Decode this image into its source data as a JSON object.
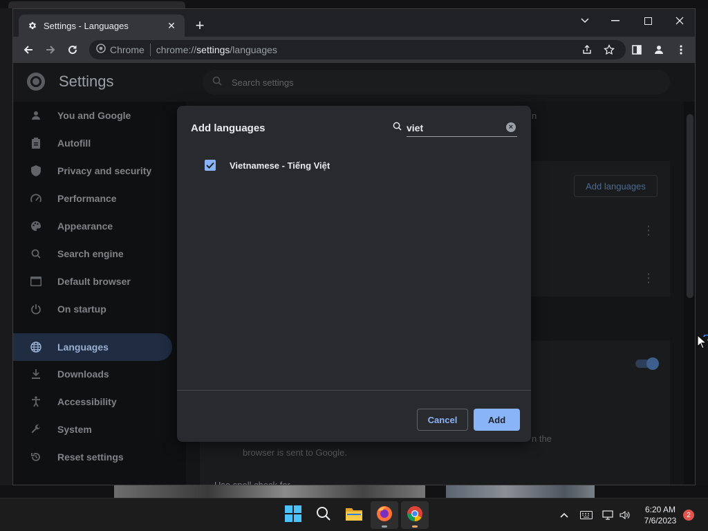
{
  "browser": {
    "tab_title": "Settings - Languages",
    "omnibox_chip": "Chrome",
    "url_scheme": "chrome://",
    "url_host": "settings",
    "url_path": "/languages"
  },
  "settings": {
    "title": "Settings",
    "search_placeholder": "Search settings",
    "nav": [
      {
        "label": "You and Google",
        "icon": "person-icon"
      },
      {
        "label": "Autofill",
        "icon": "clipboard-icon"
      },
      {
        "label": "Privacy and security",
        "icon": "shield-icon"
      },
      {
        "label": "Performance",
        "icon": "gauge-icon"
      },
      {
        "label": "Appearance",
        "icon": "palette-icon"
      },
      {
        "label": "Search engine",
        "icon": "search-icon"
      },
      {
        "label": "Default browser",
        "icon": "browser-icon"
      },
      {
        "label": "On startup",
        "icon": "power-icon"
      },
      {
        "label": "Languages",
        "icon": "globe-icon"
      },
      {
        "label": "Downloads",
        "icon": "download-icon"
      },
      {
        "label": "Accessibility",
        "icon": "accessibility-icon"
      },
      {
        "label": "System",
        "icon": "wrench-icon"
      },
      {
        "label": "Reset settings",
        "icon": "reset-icon"
      }
    ],
    "active_nav": "Languages",
    "background": {
      "add_languages_button": "Add languages",
      "partial_text_1": "n",
      "partial_text_2": "n the",
      "partial_text_3": "browser is sent to Google.",
      "spell_check_label": "Use spell check for"
    }
  },
  "dialog": {
    "title": "Add languages",
    "search_value": "viet",
    "results": [
      {
        "label": "Vietnamese - Tiếng Việt",
        "checked": true
      }
    ],
    "cancel_label": "Cancel",
    "add_label": "Add"
  },
  "taskbar": {
    "time": "6:20 AM",
    "date": "7/6/2023",
    "notification_count": "2"
  },
  "colors": {
    "accent": "#8ab4f8",
    "dialog_bg": "#292a2d",
    "toolbar_bg": "#35363a"
  }
}
